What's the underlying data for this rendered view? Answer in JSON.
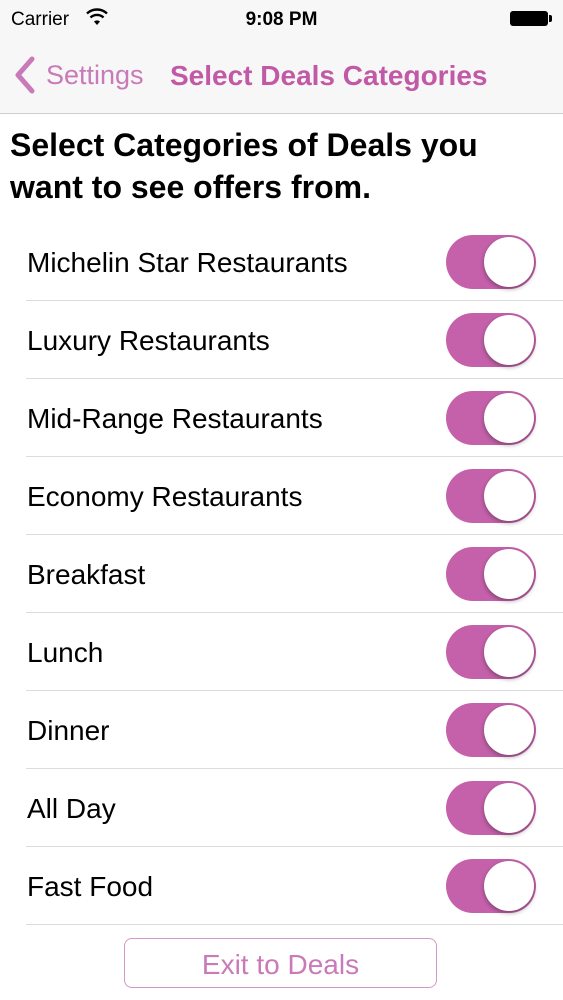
{
  "status_bar": {
    "carrier": "Carrier",
    "time": "9:08 PM",
    "wifi_icon": "wifi-icon",
    "battery_icon": "battery-icon"
  },
  "nav": {
    "back_label": "Settings",
    "back_icon": "chevron-left-icon",
    "title": "Select Deals Categories"
  },
  "heading": "Select Categories of Deals you want to see offers from.",
  "categories": [
    {
      "label": "Michelin Star Restaurants",
      "on": true
    },
    {
      "label": "Luxury Restaurants",
      "on": true
    },
    {
      "label": "Mid-Range Restaurants",
      "on": true
    },
    {
      "label": "Economy Restaurants",
      "on": true
    },
    {
      "label": "Breakfast",
      "on": true
    },
    {
      "label": "Lunch",
      "on": true
    },
    {
      "label": "Dinner",
      "on": true
    },
    {
      "label": "All Day",
      "on": true
    },
    {
      "label": "Fast Food",
      "on": true
    }
  ],
  "exit_button_label": "Exit to Deals",
  "colors": {
    "accent": "#c461aa",
    "nav_text": "#c97ab8",
    "title_text": "#c159a6"
  }
}
